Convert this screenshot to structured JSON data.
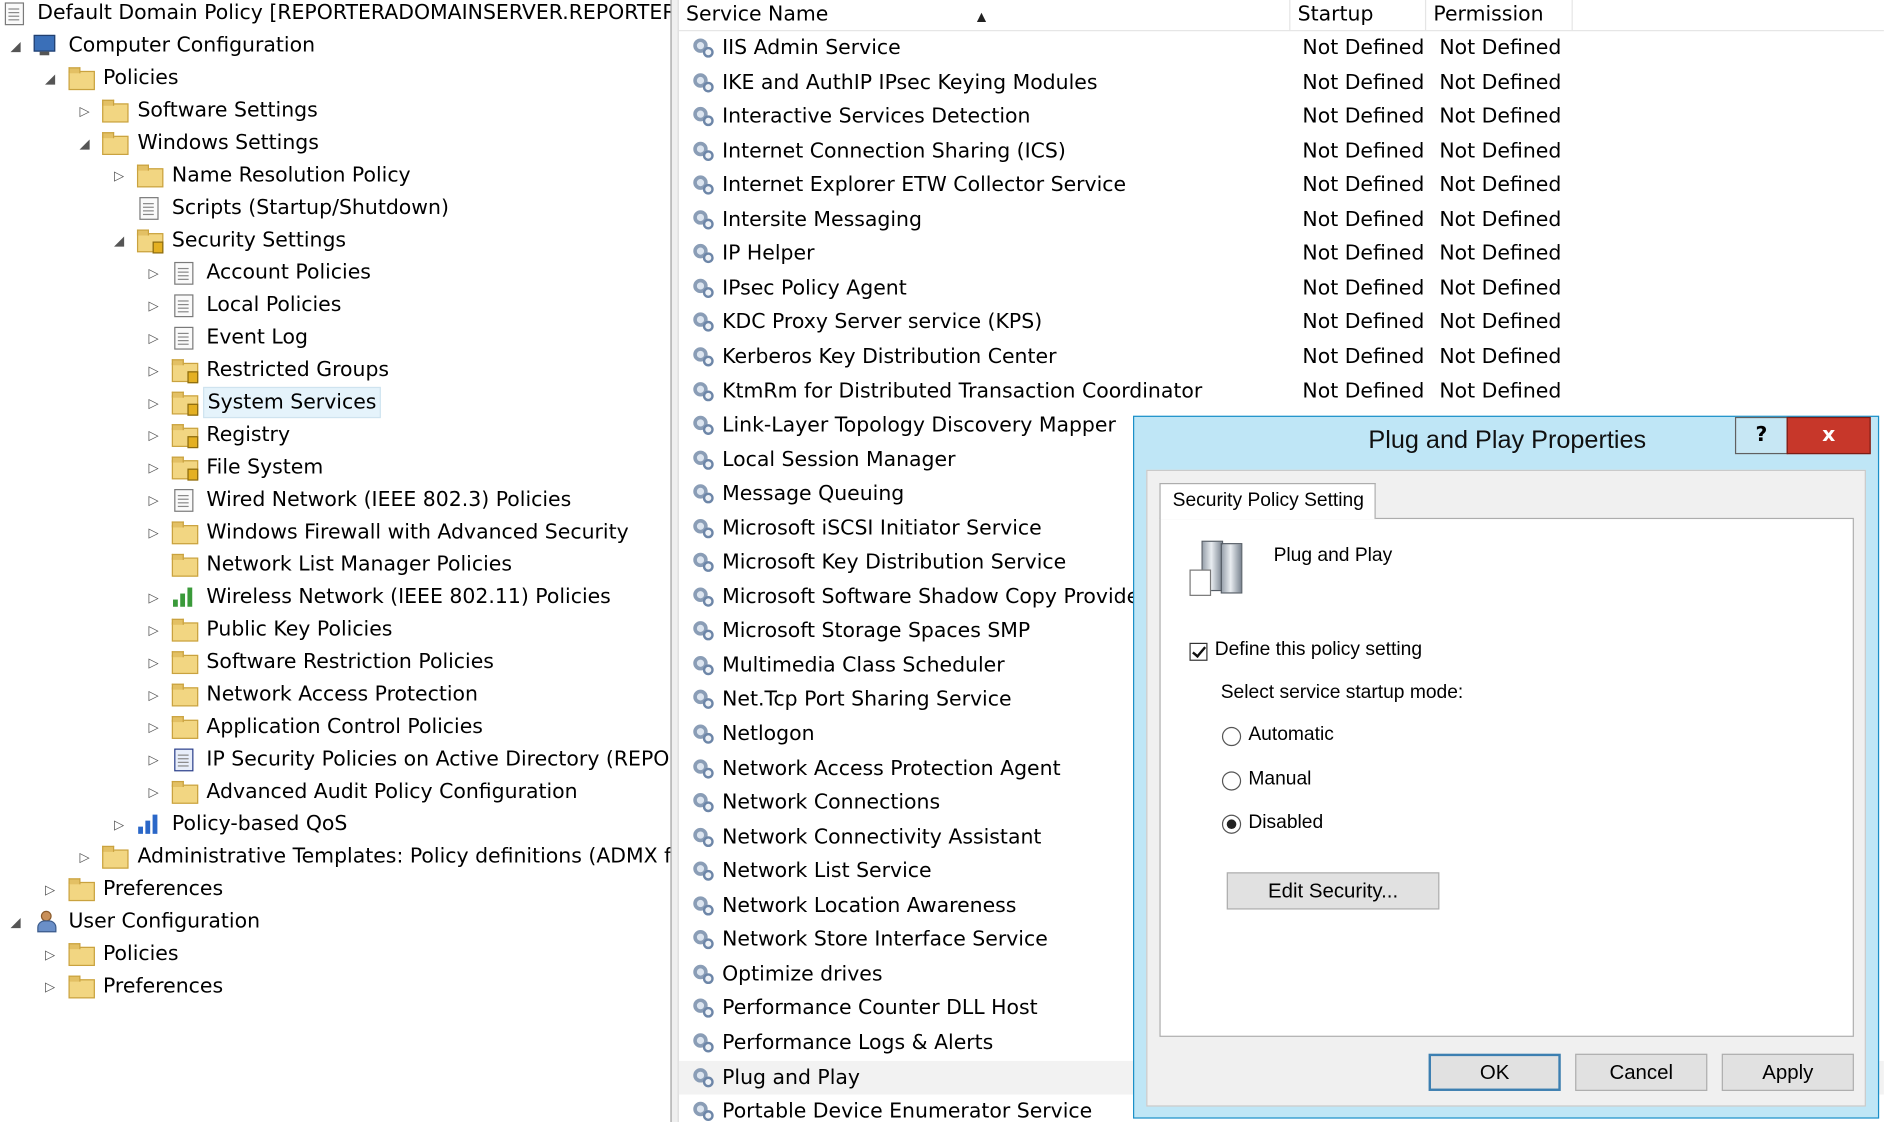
{
  "tree": {
    "items": [
      {
        "label": "Default Domain Policy [REPORTERADOMAINSERVER.REPORTERA.L",
        "level": 0,
        "toggle": "none",
        "icon": "policy-doc-icon"
      },
      {
        "label": "Computer Configuration",
        "level": 0,
        "toggle": "expanded",
        "icon": "computer-icon"
      },
      {
        "label": "Policies",
        "level": 1,
        "toggle": "expanded",
        "icon": "folder-icon"
      },
      {
        "label": "Software Settings",
        "level": 2,
        "toggle": "collapsed",
        "icon": "folder-icon"
      },
      {
        "label": "Windows Settings",
        "level": 2,
        "toggle": "expanded",
        "icon": "folder-icon"
      },
      {
        "label": "Name Resolution Policy",
        "level": 3,
        "toggle": "collapsed",
        "icon": "folder-icon"
      },
      {
        "label": "Scripts (Startup/Shutdown)",
        "level": 3,
        "toggle": "none",
        "icon": "script-icon"
      },
      {
        "label": "Security Settings",
        "level": 3,
        "toggle": "expanded",
        "icon": "security-settings-icon"
      },
      {
        "label": "Account Policies",
        "level": 4,
        "toggle": "collapsed",
        "icon": "policy-book-icon"
      },
      {
        "label": "Local Policies",
        "level": 4,
        "toggle": "collapsed",
        "icon": "policy-book-icon"
      },
      {
        "label": "Event Log",
        "level": 4,
        "toggle": "collapsed",
        "icon": "policy-book-icon"
      },
      {
        "label": "Restricted Groups",
        "level": 4,
        "toggle": "collapsed",
        "icon": "locked-folder-icon"
      },
      {
        "label": "System Services",
        "level": 4,
        "toggle": "collapsed",
        "icon": "locked-folder-icon",
        "selected": true
      },
      {
        "label": "Registry",
        "level": 4,
        "toggle": "collapsed",
        "icon": "locked-folder-icon"
      },
      {
        "label": "File System",
        "level": 4,
        "toggle": "collapsed",
        "icon": "locked-folder-icon"
      },
      {
        "label": "Wired Network (IEEE 802.3) Policies",
        "level": 4,
        "toggle": "collapsed",
        "icon": "wired-network-icon"
      },
      {
        "label": "Windows Firewall with Advanced Security",
        "level": 4,
        "toggle": "collapsed",
        "icon": "folder-icon"
      },
      {
        "label": "Network List Manager Policies",
        "level": 4,
        "toggle": "none",
        "icon": "folder-icon"
      },
      {
        "label": "Wireless Network (IEEE 802.11) Policies",
        "level": 4,
        "toggle": "collapsed",
        "icon": "wireless-network-icon"
      },
      {
        "label": "Public Key Policies",
        "level": 4,
        "toggle": "collapsed",
        "icon": "folder-icon"
      },
      {
        "label": "Software Restriction Policies",
        "level": 4,
        "toggle": "collapsed",
        "icon": "folder-icon"
      },
      {
        "label": "Network Access Protection",
        "level": 4,
        "toggle": "collapsed",
        "icon": "folder-icon"
      },
      {
        "label": "Application Control Policies",
        "level": 4,
        "toggle": "collapsed",
        "icon": "folder-icon"
      },
      {
        "label": "IP Security Policies on Active Directory (REPORTE",
        "level": 4,
        "toggle": "collapsed",
        "icon": "ip-security-icon"
      },
      {
        "label": "Advanced Audit Policy Configuration",
        "level": 4,
        "toggle": "collapsed",
        "icon": "folder-icon"
      },
      {
        "label": "Policy-based QoS",
        "level": 3,
        "toggle": "collapsed",
        "icon": "qos-chart-icon"
      },
      {
        "label": "Administrative Templates: Policy definitions (ADMX files",
        "level": 2,
        "toggle": "collapsed",
        "icon": "folder-icon"
      },
      {
        "label": "Preferences",
        "level": 1,
        "toggle": "collapsed",
        "icon": "folder-icon"
      },
      {
        "label": "User Configuration",
        "level": 0,
        "toggle": "expanded",
        "icon": "user-icon"
      },
      {
        "label": "Policies",
        "level": 1,
        "toggle": "collapsed",
        "icon": "folder-icon"
      },
      {
        "label": "Preferences",
        "level": 1,
        "toggle": "collapsed",
        "icon": "folder-icon"
      }
    ]
  },
  "list": {
    "columns": [
      "Service Name",
      "Startup",
      "Permission"
    ],
    "rows": [
      {
        "name": "IIS Admin Service",
        "startup": "Not Defined",
        "permission": "Not Defined"
      },
      {
        "name": "IKE and AuthIP IPsec Keying Modules",
        "startup": "Not Defined",
        "permission": "Not Defined"
      },
      {
        "name": "Interactive Services Detection",
        "startup": "Not Defined",
        "permission": "Not Defined"
      },
      {
        "name": "Internet Connection Sharing (ICS)",
        "startup": "Not Defined",
        "permission": "Not Defined"
      },
      {
        "name": "Internet Explorer ETW Collector Service",
        "startup": "Not Defined",
        "permission": "Not Defined"
      },
      {
        "name": "Intersite Messaging",
        "startup": "Not Defined",
        "permission": "Not Defined"
      },
      {
        "name": "IP Helper",
        "startup": "Not Defined",
        "permission": "Not Defined"
      },
      {
        "name": "IPsec Policy Agent",
        "startup": "Not Defined",
        "permission": "Not Defined"
      },
      {
        "name": "KDC Proxy Server service (KPS)",
        "startup": "Not Defined",
        "permission": "Not Defined"
      },
      {
        "name": "Kerberos Key Distribution Center",
        "startup": "Not Defined",
        "permission": "Not Defined"
      },
      {
        "name": "KtmRm for Distributed Transaction Coordinator",
        "startup": "Not Defined",
        "permission": "Not Defined"
      },
      {
        "name": "Link-Layer Topology Discovery Mapper",
        "startup": "",
        "permission": ""
      },
      {
        "name": "Local Session Manager",
        "startup": "",
        "permission": ""
      },
      {
        "name": "Message Queuing",
        "startup": "",
        "permission": ""
      },
      {
        "name": "Microsoft iSCSI Initiator Service",
        "startup": "",
        "permission": ""
      },
      {
        "name": "Microsoft Key Distribution Service",
        "startup": "",
        "permission": ""
      },
      {
        "name": "Microsoft Software Shadow Copy Provider",
        "startup": "",
        "permission": ""
      },
      {
        "name": "Microsoft Storage Spaces SMP",
        "startup": "",
        "permission": ""
      },
      {
        "name": "Multimedia Class Scheduler",
        "startup": "",
        "permission": ""
      },
      {
        "name": "Net.Tcp Port Sharing Service",
        "startup": "",
        "permission": ""
      },
      {
        "name": "Netlogon",
        "startup": "",
        "permission": ""
      },
      {
        "name": "Network Access Protection Agent",
        "startup": "",
        "permission": ""
      },
      {
        "name": "Network Connections",
        "startup": "",
        "permission": ""
      },
      {
        "name": "Network Connectivity Assistant",
        "startup": "",
        "permission": ""
      },
      {
        "name": "Network List Service",
        "startup": "",
        "permission": ""
      },
      {
        "name": "Network Location Awareness",
        "startup": "",
        "permission": ""
      },
      {
        "name": "Network Store Interface Service",
        "startup": "",
        "permission": ""
      },
      {
        "name": "Optimize drives",
        "startup": "",
        "permission": ""
      },
      {
        "name": "Performance Counter DLL Host",
        "startup": "",
        "permission": ""
      },
      {
        "name": "Performance Logs & Alerts",
        "startup": "",
        "permission": ""
      },
      {
        "name": "Plug and Play",
        "startup": "",
        "permission": "",
        "highlighted": true
      },
      {
        "name": "Portable Device Enumerator Service",
        "startup": "",
        "permission": ""
      }
    ]
  },
  "dialog": {
    "title": "Plug and Play Properties",
    "help_label": "?",
    "close_label": "x",
    "tab_label": "Security Policy Setting",
    "policy_name": "Plug and Play",
    "define_label": "Define this policy setting",
    "define_checked": true,
    "startup_mode_label": "Select service startup mode:",
    "options": [
      {
        "label": "Automatic",
        "checked": false
      },
      {
        "label": "Manual",
        "checked": false
      },
      {
        "label": "Disabled",
        "checked": true
      }
    ],
    "edit_security_label": "Edit Security...",
    "ok_label": "OK",
    "cancel_label": "Cancel",
    "apply_label": "Apply"
  }
}
